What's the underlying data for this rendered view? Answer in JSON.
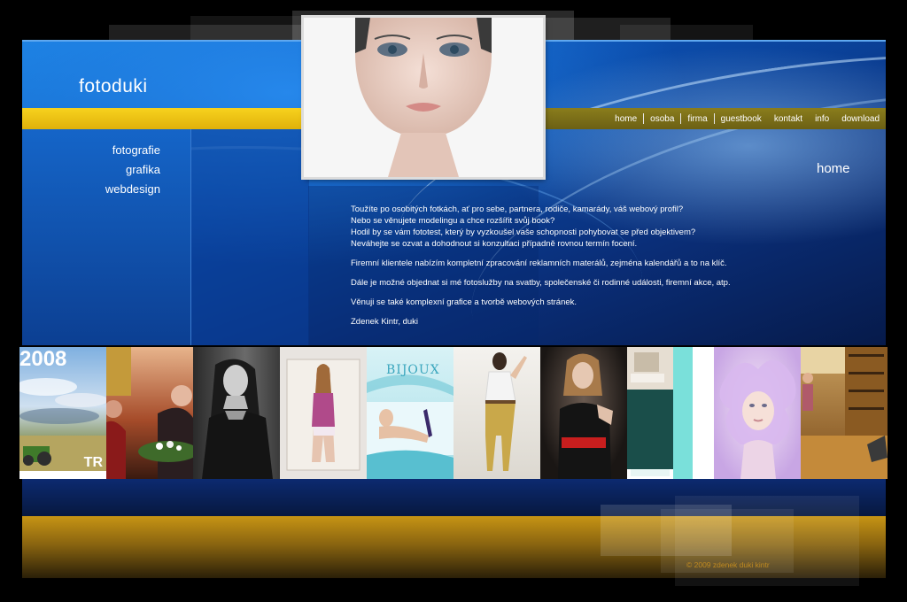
{
  "site": {
    "logo": "fotoduki",
    "page_heading": "home",
    "copyright": "© 2009 zdenek duki kintr"
  },
  "nav": {
    "items": [
      {
        "label": "home"
      },
      {
        "label": "osoba"
      },
      {
        "label": "firma"
      },
      {
        "label": "guestbook"
      },
      {
        "label": "kontakt"
      },
      {
        "label": "info"
      },
      {
        "label": "download"
      }
    ]
  },
  "sidebar": {
    "items": [
      {
        "label": "fotografie"
      },
      {
        "label": "grafika"
      },
      {
        "label": "webdesign"
      }
    ]
  },
  "content": {
    "lines": [
      "Toužíte po osobitých fotkách, ať pro sebe, partnera, rodiče, kamarády, váš webový profil?",
      "Nebo se věnujete modelingu a chce rozšířit svůj book?",
      "Hodil by se vám fototest, který by vyzkoušel vaše schopnosti pohybovat se před objektivem?",
      "Neváhejte se ozvat a dohodnout si konzultaci případně rovnou termín focení."
    ],
    "p2": "Firemní klientele nabízím kompletní zpracování reklamních materálů, zejména kalendářů a to na klíč.",
    "p3": "Dále je možné objednat si mé fotoslužby na svatby, společenské či rodinné události, firemní akce, atp.",
    "p4": "Věnuji se také komplexní grafice a tvorbě webových stránek.",
    "signature": "Zdenek Kintr, duki"
  },
  "gallery": {
    "thumb1_year": "2008",
    "thumb1_tag": "TR",
    "thumb5_brand": "BIJOUX"
  },
  "colors": {
    "accent_yellow": "#f2c814",
    "frame_blue": "#0b4fb0",
    "nav_bar": "#7a6d18",
    "gold": "#c79414"
  }
}
